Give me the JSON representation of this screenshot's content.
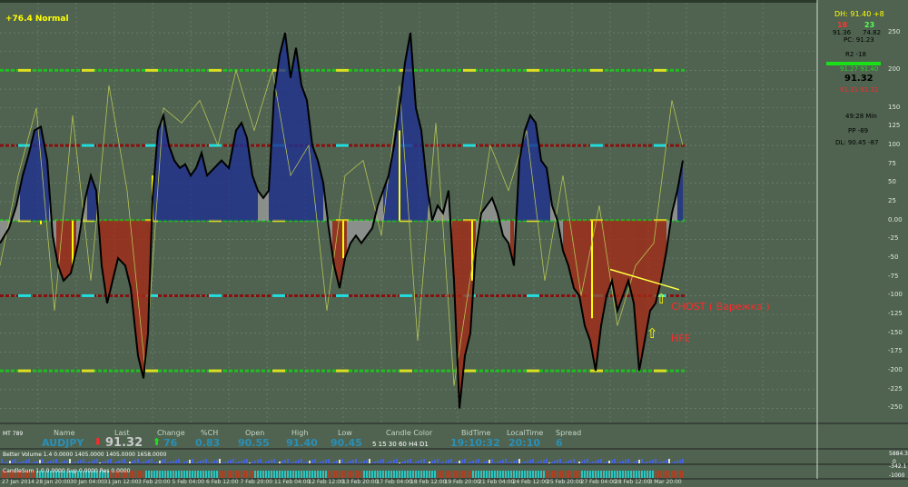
{
  "indicator_label": "+76.4 Normal",
  "info_panel": {
    "dh": "DH: 91.40 +8",
    "count_red": "18",
    "count_green": "23",
    "low_val": "91.36",
    "high_val": "74.82",
    "pc": "PC: 91.23",
    "r2": "R2 -18",
    "green_row": "91.27 91.40",
    "price": "91.32",
    "red_row": "91.31 91.32",
    "timer": "49:28 Min",
    "pp": "PP -89",
    "dl": "DL: 90.45 -87"
  },
  "annotations": {
    "chost": "CHOST  ( Варежка )",
    "hfe": "HFE"
  },
  "colors": {
    "background": "#4f6350",
    "grid": "#788a78",
    "above_fill": "#1f2f8f",
    "below_fill": "#a22a16",
    "neutral_fill": "#9a9a9a",
    "main_line": "#000000",
    "signal_line": "#b6c454",
    "level_outer": "#1fbf1f",
    "level_inner": "#8a1010",
    "cyan": "#22dddd",
    "annotation_red": "#ff2a2a",
    "arrow_yellow": "#ffff00"
  },
  "y_axis_ticks": [
    "250",
    "200",
    "150",
    "100",
    "50",
    "0.00",
    "-50",
    "-100",
    "-150",
    "-200",
    "-250"
  ],
  "y_axis_extra_ticks": [
    "125",
    "75",
    "25",
    "-25",
    "-75",
    "-125",
    "-175",
    "-225"
  ],
  "watch": {
    "mt_label": "MT 789",
    "headers": [
      "Name",
      "Last",
      "Change",
      "%CH",
      "Open",
      "High",
      "Low",
      "Candle Color",
      "BidTime",
      "LocalTime",
      "Spread"
    ],
    "name": "AUDJPY",
    "last": "91.32",
    "change": "76",
    "pct": "0.83",
    "open": "90.55",
    "high": "91.40",
    "low": "90.45",
    "candle_tfs": "5  15  30  60  H4  D1",
    "bidtime": "19:10:32",
    "localtime": "20:10",
    "spread": "6"
  },
  "sub1": {
    "label": "Better Volume 1.4  0.0000 1405.0000 1405.0000 1658.0000",
    "ticks": [
      "5884.3",
      "0"
    ]
  },
  "sub2": {
    "label": "CandleSum 1.0  0.0000  Sup 0.0000 Res 0.0000",
    "ticks": [
      "-342.1",
      "-1000"
    ]
  },
  "x_axis_dates": [
    "27 Jan 2014",
    "28 Jan 20:00",
    "30 Jan 04:00",
    "31 Jan 12:00",
    "3 Feb 20:00",
    "5 Feb 04:00",
    "6 Feb 12:00",
    "7 Feb 20:00",
    "11 Feb 04:00",
    "12 Feb 12:00",
    "13 Feb 20:00",
    "17 Feb 04:00",
    "18 Feb 12:00",
    "19 Feb 20:00",
    "21 Feb 04:00",
    "24 Feb 12:00",
    "25 Feb 20:00",
    "27 Feb 04:00",
    "28 Feb 12:00",
    "3 Mar 20:00"
  ],
  "chart_data": {
    "type": "line",
    "title": "",
    "xlabel": "",
    "ylabel": "",
    "ylim": [
      -270,
      290
    ],
    "x": [
      "27 Jan 2014",
      "28 Jan 20:00",
      "30 Jan 04:00",
      "31 Jan 12:00",
      "3 Feb 20:00",
      "5 Feb 04:00",
      "6 Feb 12:00",
      "7 Feb 20:00",
      "11 Feb 04:00",
      "12 Feb 12:00",
      "13 Feb 20:00",
      "17 Feb 04:00",
      "18 Feb 12:00",
      "19 Feb 20:00",
      "21 Feb 04:00",
      "24 Feb 12:00",
      "25 Feb 20:00",
      "27 Feb 04:00",
      "28 Feb 12:00",
      "3 Mar 20:00"
    ],
    "levels": [
      200,
      100,
      0,
      -100,
      -200
    ],
    "series": [
      {
        "points": [
          [
            0,
            -30
          ],
          [
            10,
            -10
          ],
          [
            18,
            20
          ],
          [
            25,
            60
          ],
          [
            32,
            90
          ],
          [
            38,
            120
          ],
          [
            45,
            125
          ],
          [
            52,
            80
          ],
          [
            58,
            -20
          ],
          [
            64,
            -60
          ],
          [
            70,
            -80
          ],
          [
            78,
            -70
          ],
          [
            86,
            -30
          ],
          [
            94,
            30
          ],
          [
            100,
            60
          ],
          [
            106,
            40
          ],
          [
            112,
            -60
          ],
          [
            118,
            -110
          ],
          [
            124,
            -80
          ],
          [
            130,
            -50
          ],
          [
            138,
            -60
          ],
          [
            144,
            -90
          ],
          [
            152,
            -180
          ],
          [
            158,
            -210
          ],
          [
            163,
            -150
          ],
          [
            168,
            30
          ],
          [
            174,
            120
          ],
          [
            180,
            140
          ],
          [
            186,
            100
          ],
          [
            192,
            80
          ],
          [
            198,
            70
          ],
          [
            204,
            75
          ],
          [
            210,
            60
          ],
          [
            216,
            70
          ],
          [
            222,
            90
          ],
          [
            228,
            60
          ],
          [
            236,
            70
          ],
          [
            244,
            80
          ],
          [
            252,
            70
          ],
          [
            260,
            120
          ],
          [
            266,
            130
          ],
          [
            272,
            110
          ],
          [
            278,
            60
          ],
          [
            284,
            40
          ],
          [
            290,
            30
          ],
          [
            296,
            40
          ],
          [
            302,
            170
          ],
          [
            308,
            220
          ],
          [
            314,
            250
          ],
          [
            320,
            190
          ],
          [
            326,
            230
          ],
          [
            332,
            180
          ],
          [
            338,
            160
          ],
          [
            344,
            100
          ],
          [
            350,
            80
          ],
          [
            356,
            50
          ],
          [
            362,
            -10
          ],
          [
            368,
            -60
          ],
          [
            374,
            -90
          ],
          [
            380,
            -50
          ],
          [
            386,
            -30
          ],
          [
            392,
            -20
          ],
          [
            398,
            -30
          ],
          [
            404,
            -20
          ],
          [
            410,
            -10
          ],
          [
            416,
            20
          ],
          [
            422,
            40
          ],
          [
            428,
            60
          ],
          [
            434,
            100
          ],
          [
            440,
            150
          ],
          [
            446,
            210
          ],
          [
            452,
            250
          ],
          [
            458,
            150
          ],
          [
            464,
            120
          ],
          [
            470,
            50
          ],
          [
            476,
            0
          ],
          [
            482,
            20
          ],
          [
            488,
            10
          ],
          [
            494,
            40
          ],
          [
            500,
            -80
          ],
          [
            506,
            -250
          ],
          [
            512,
            -180
          ],
          [
            518,
            -150
          ],
          [
            524,
            -40
          ],
          [
            530,
            10
          ],
          [
            536,
            20
          ],
          [
            542,
            30
          ],
          [
            548,
            10
          ],
          [
            554,
            -20
          ],
          [
            560,
            -30
          ],
          [
            566,
            -60
          ],
          [
            572,
            80
          ],
          [
            578,
            120
          ],
          [
            584,
            140
          ],
          [
            590,
            130
          ],
          [
            596,
            80
          ],
          [
            602,
            70
          ],
          [
            608,
            20
          ],
          [
            614,
            0
          ],
          [
            620,
            -40
          ],
          [
            626,
            -60
          ],
          [
            632,
            -90
          ],
          [
            638,
            -100
          ],
          [
            644,
            -140
          ],
          [
            650,
            -160
          ],
          [
            656,
            -200
          ],
          [
            662,
            -140
          ],
          [
            668,
            -100
          ],
          [
            674,
            -80
          ],
          [
            680,
            -120
          ],
          [
            686,
            -100
          ],
          [
            692,
            -80
          ],
          [
            698,
            -110
          ],
          [
            704,
            -200
          ],
          [
            710,
            -160
          ],
          [
            716,
            -120
          ],
          [
            722,
            -110
          ],
          [
            728,
            -80
          ],
          [
            734,
            -40
          ],
          [
            740,
            10
          ],
          [
            746,
            40
          ],
          [
            752,
            80
          ]
        ]
      },
      {
        "points": [
          [
            0,
            -60
          ],
          [
            20,
            60
          ],
          [
            40,
            150
          ],
          [
            60,
            -120
          ],
          [
            80,
            140
          ],
          [
            100,
            -80
          ],
          [
            120,
            180
          ],
          [
            140,
            40
          ],
          [
            160,
            -200
          ],
          [
            180,
            150
          ],
          [
            200,
            130
          ],
          [
            220,
            160
          ],
          [
            240,
            100
          ],
          [
            260,
            200
          ],
          [
            280,
            120
          ],
          [
            300,
            200
          ],
          [
            320,
            60
          ],
          [
            340,
            100
          ],
          [
            360,
            -120
          ],
          [
            380,
            60
          ],
          [
            400,
            80
          ],
          [
            420,
            -20
          ],
          [
            440,
            180
          ],
          [
            460,
            -160
          ],
          [
            480,
            130
          ],
          [
            500,
            -220
          ],
          [
            520,
            -60
          ],
          [
            540,
            100
          ],
          [
            560,
            40
          ],
          [
            580,
            120
          ],
          [
            600,
            -80
          ],
          [
            620,
            60
          ],
          [
            640,
            -100
          ],
          [
            660,
            20
          ],
          [
            680,
            -140
          ],
          [
            700,
            -60
          ],
          [
            720,
            -30
          ],
          [
            740,
            160
          ],
          [
            752,
            100
          ]
        ]
      }
    ]
  }
}
